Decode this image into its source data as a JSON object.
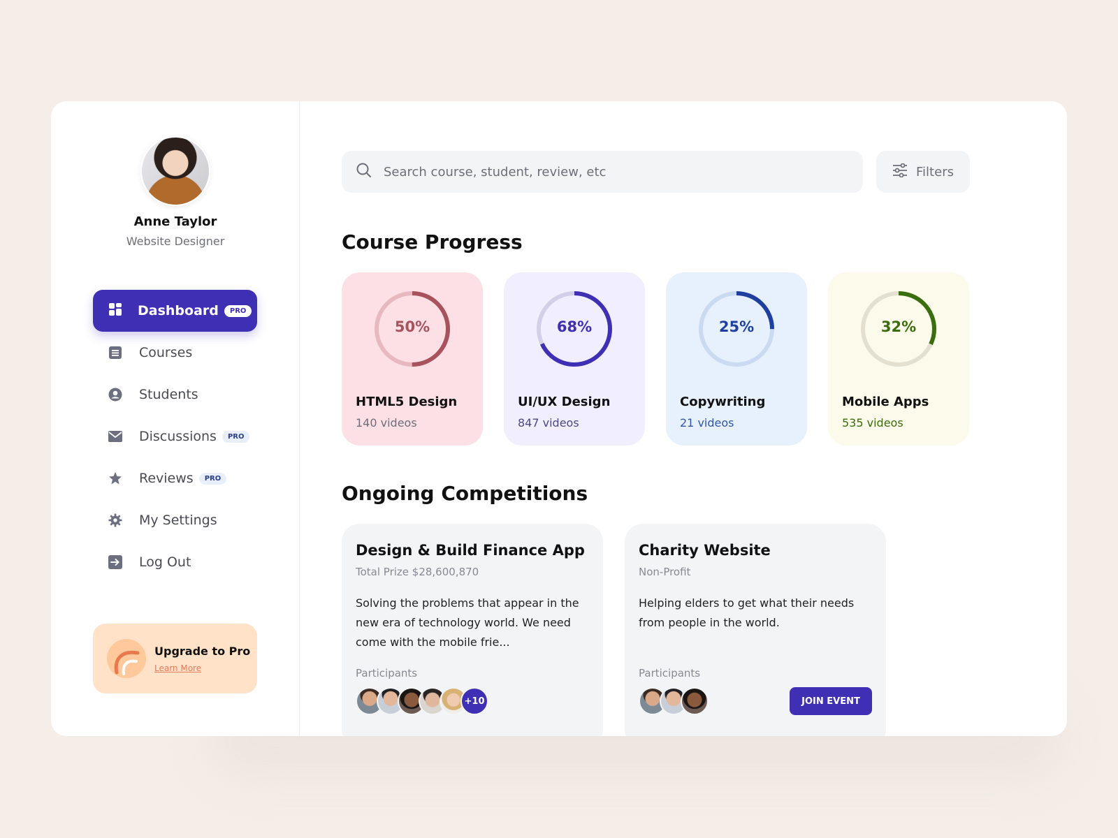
{
  "profile": {
    "name": "Anne Taylor",
    "role": "Website Designer"
  },
  "nav": {
    "active": {
      "label": "Dashboard",
      "badge": "PRO"
    },
    "items": [
      {
        "label": "Courses",
        "icon": "document-icon",
        "badge": ""
      },
      {
        "label": "Students",
        "icon": "user-circle-icon",
        "badge": ""
      },
      {
        "label": "Discussions",
        "icon": "mail-icon",
        "badge": "PRO"
      },
      {
        "label": "Reviews",
        "icon": "star-icon",
        "badge": "PRO"
      },
      {
        "label": "My Settings",
        "icon": "gear-icon",
        "badge": ""
      },
      {
        "label": "Log Out",
        "icon": "logout-icon",
        "badge": ""
      }
    ]
  },
  "upgrade": {
    "title": "Upgrade to Pro",
    "link": "Learn More"
  },
  "search": {
    "placeholder": "Search course, student, review, etc"
  },
  "filters": {
    "label": "Filters"
  },
  "course_progress": {
    "title": "Course Progress",
    "courses": [
      {
        "name": "HTML5 Design",
        "videos": "140 videos",
        "percent_label": "50%",
        "progress": 0.5,
        "bg": "#fce0e5",
        "ring": "#a8525e",
        "track": "#e8b8c0",
        "text": "#a8525e",
        "sub": "#6e6e78"
      },
      {
        "name": "UI/UX Design",
        "videos": "847 videos",
        "percent_label": "68%",
        "progress": 0.68,
        "bg": "#f1efff",
        "ring": "#3f2fb5",
        "track": "#d4cfe8",
        "text": "#3f2fb5",
        "sub": "#4d4788"
      },
      {
        "name": "Copywriting",
        "videos": "21 videos",
        "percent_label": "25%",
        "progress": 0.25,
        "bg": "#e7f1fd",
        "ring": "#1e3fa0",
        "track": "#c9daf1",
        "text": "#1e3fa0",
        "sub": "#3257a8"
      },
      {
        "name": "Mobile Apps",
        "videos": "535 videos",
        "percent_label": "32%",
        "progress": 0.32,
        "bg": "#fcfaea",
        "ring": "#3a6d0e",
        "track": "#e3e0d0",
        "text": "#3a6d0e",
        "sub": "#3a6d0e"
      }
    ]
  },
  "competitions": {
    "title": "Ongoing Competitions",
    "items": [
      {
        "title": "Design & Build Finance App",
        "subtitle": "Total Prize $28,600,870",
        "description": "Solving the problems that appear in the new era of technology world. We need come with the mobile frie...",
        "participants_label": "Participants",
        "more": "+10"
      },
      {
        "title": "Charity Website",
        "subtitle": "Non-Profit",
        "description": "Helping elders to get what their needs from people in the world.",
        "participants_label": "Participants",
        "button": "JOIN EVENT"
      }
    ]
  },
  "colors": {
    "accent": "#3f2fb5",
    "background": "#f4ede8"
  }
}
